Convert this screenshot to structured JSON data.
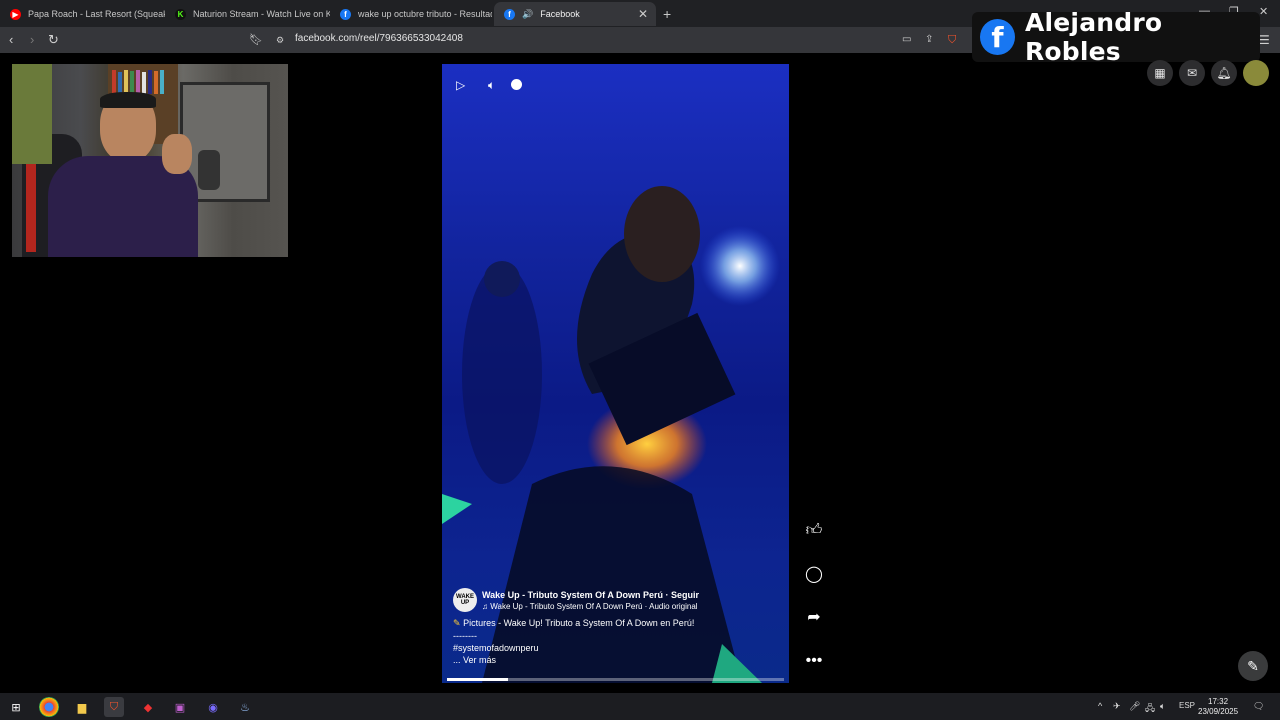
{
  "browser": {
    "tabs": [
      {
        "title": "Papa Roach - Last Resort (Squeaky Cl",
        "favicon": "youtube-icon",
        "color": "#ff0000"
      },
      {
        "title": "Naturion Stream - Watch Live on Kick",
        "favicon": "kick-icon",
        "color": "#53fc18"
      },
      {
        "title": "wake up octubre tributo - Resultado",
        "favicon": "facebook-icon",
        "color": "#1877f2"
      },
      {
        "title": "Facebook",
        "favicon": "facebook-icon",
        "color": "#1877f2",
        "active": true
      }
    ],
    "new_tab": "+",
    "url": "facebook.com/reel/796366533042408"
  },
  "overlay": {
    "name": "Alejandro Robles",
    "logo_letter": "f"
  },
  "reel": {
    "page_name": "Wake Up - Tributo System Of A Down Perú",
    "follow": "· Seguir",
    "audio": "Wake Up - Tributo System Of A Down Perú · Audio original",
    "avatar_text": "WAKE UP",
    "description": "Pictures - Wake Up! Tributo a System Of A Down en Perú!",
    "divider": "--------",
    "hashtag": "#systemofadownperu",
    "see_more": "... Ver más",
    "progress": 0.18
  },
  "taskbar": {
    "language": "ESP",
    "time": "17:32",
    "date": "23/09/2025"
  }
}
